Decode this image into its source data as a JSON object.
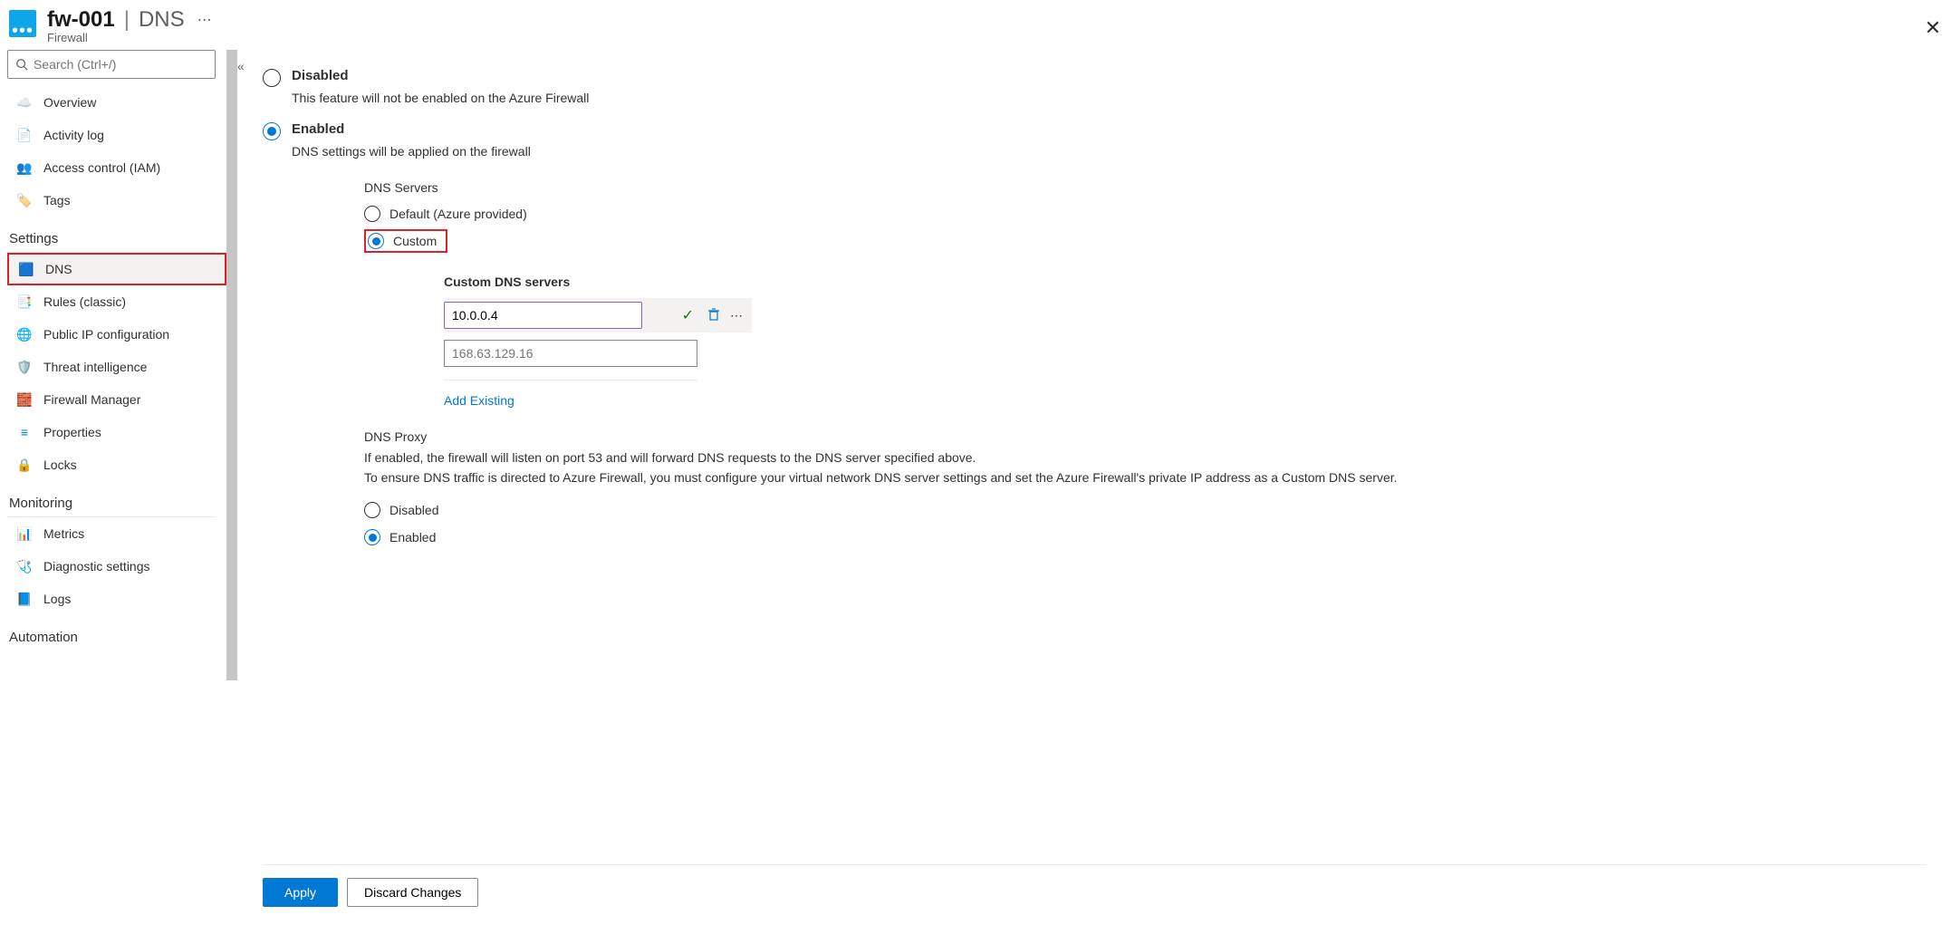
{
  "header": {
    "resource_name": "fw-001",
    "separator": "|",
    "blade": "DNS",
    "subtitle": "Firewall"
  },
  "search": {
    "placeholder": "Search (Ctrl+/)"
  },
  "sidebar": {
    "items": [
      {
        "label": "Overview"
      },
      {
        "label": "Activity log"
      },
      {
        "label": "Access control (IAM)"
      },
      {
        "label": "Tags"
      }
    ],
    "section_settings": "Settings",
    "settings_items": [
      {
        "label": "DNS"
      },
      {
        "label": "Rules (classic)"
      },
      {
        "label": "Public IP configuration"
      },
      {
        "label": "Threat intelligence"
      },
      {
        "label": "Firewall Manager"
      },
      {
        "label": "Properties"
      },
      {
        "label": "Locks"
      }
    ],
    "section_monitoring": "Monitoring",
    "monitoring_items": [
      {
        "label": "Metrics"
      },
      {
        "label": "Diagnostic settings"
      },
      {
        "label": "Logs"
      }
    ],
    "section_automation": "Automation"
  },
  "dns": {
    "disabled_label": "Disabled",
    "disabled_desc": "This feature will not be enabled on the Azure Firewall",
    "enabled_label": "Enabled",
    "enabled_desc": "DNS settings will be applied on the firewall",
    "servers_heading": "DNS Servers",
    "servers_default": "Default (Azure provided)",
    "servers_custom": "Custom",
    "custom_heading": "Custom DNS servers",
    "server_value": "10.0.0.4",
    "server_placeholder": "168.63.129.16",
    "add_existing": "Add Existing",
    "proxy_heading": "DNS Proxy",
    "proxy_line1": "If enabled, the firewall will listen on port 53 and will forward DNS requests to the DNS server specified above.",
    "proxy_line2": "To ensure DNS traffic is directed to Azure Firewall, you must configure your virtual network DNS server settings and set the Azure Firewall's private IP address as a Custom DNS server.",
    "proxy_disabled": "Disabled",
    "proxy_enabled": "Enabled"
  },
  "footer": {
    "apply": "Apply",
    "discard": "Discard Changes"
  }
}
